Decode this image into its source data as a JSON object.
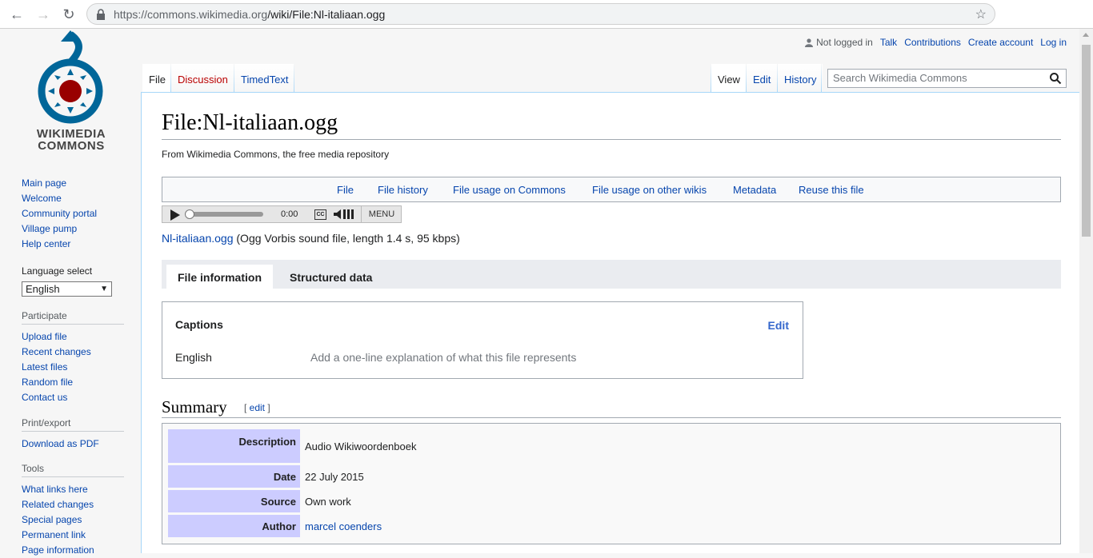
{
  "browser": {
    "url_host": "https://commons.wikimedia.org",
    "url_path": "/wiki/File:Nl-italiaan.ogg"
  },
  "logo": {
    "line1": "WIKIMEDIA",
    "line2": "COMMONS"
  },
  "sidebar": {
    "nav": [
      "Main page",
      "Welcome",
      "Community portal",
      "Village pump",
      "Help center"
    ],
    "language_heading": "Language select",
    "language_value": "English",
    "participate_heading": "Participate",
    "participate": [
      "Upload file",
      "Recent changes",
      "Latest files",
      "Random file",
      "Contact us"
    ],
    "print_heading": "Print/export",
    "print": [
      "Download as PDF"
    ],
    "tools_heading": "Tools",
    "tools": [
      "What links here",
      "Related changes",
      "Special pages",
      "Permanent link",
      "Page information"
    ]
  },
  "personal": {
    "not_logged_in": "Not logged in",
    "talk": "Talk",
    "contributions": "Contributions",
    "create_account": "Create account",
    "log_in": "Log in"
  },
  "tabs": {
    "file": "File",
    "discussion": "Discussion",
    "timedtext": "TimedText",
    "view": "View",
    "edit": "Edit",
    "history": "History"
  },
  "search": {
    "placeholder": "Search Wikimedia Commons"
  },
  "page": {
    "title": "File:Nl-italiaan.ogg",
    "tagline": "From Wikimedia Commons, the free media repository",
    "toc": [
      "File",
      "File history",
      "File usage on Commons",
      "File usage on other wikis",
      "Metadata",
      "Reuse this file"
    ],
    "player_time": "0:00",
    "player_cc": "CC",
    "player_menu": "MENU",
    "file_link": "Nl-italiaan.ogg",
    "file_desc": " (Ogg Vorbis sound file, length 1.4 s, 95 kbps)",
    "tab_file_info": "File information",
    "tab_structured": "Structured data",
    "captions_title": "Captions",
    "captions_edit": "Edit",
    "captions_lang": "English",
    "captions_placeholder": "Add a one-line explanation of what this file represents",
    "summary_heading": "Summary",
    "summary_edit_open": "[ ",
    "summary_edit": "edit",
    "summary_edit_close": " ]",
    "summary_rows": [
      {
        "label": "Description",
        "value": "Audio Wikiwoordenboek"
      },
      {
        "label": "Date",
        "value": "22 July 2015"
      },
      {
        "label": "Source",
        "value": "Own work"
      },
      {
        "label": "Author",
        "value": "marcel coenders"
      }
    ]
  },
  "colors": {
    "link": "#0645ad",
    "summary_label_bg": "#ccccff",
    "tab_border": "#a7d7f9"
  }
}
